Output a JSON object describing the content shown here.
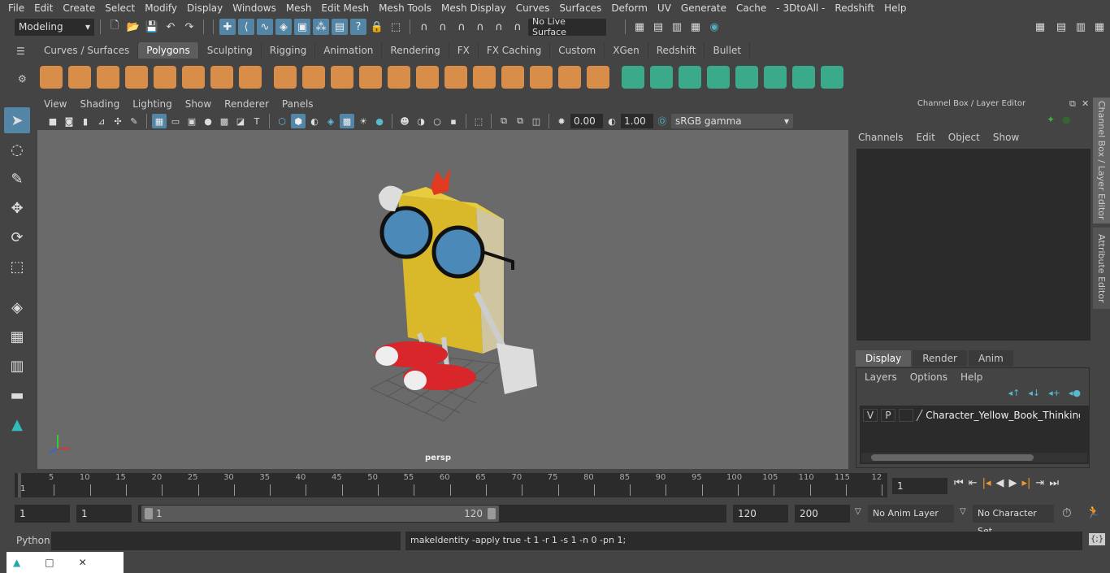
{
  "menubar": [
    "File",
    "Edit",
    "Create",
    "Select",
    "Modify",
    "Display",
    "Windows",
    "Mesh",
    "Edit Mesh",
    "Mesh Tools",
    "Mesh Display",
    "Curves",
    "Surfaces",
    "Deform",
    "UV",
    "Generate",
    "Cache",
    "- 3DtoAll -",
    "Redshift",
    "Help"
  ],
  "status": {
    "workspace": "Modeling",
    "live_surface": "No Live Surface"
  },
  "shelf_tabs": [
    "Curves / Surfaces",
    "Polygons",
    "Sculpting",
    "Rigging",
    "Animation",
    "Rendering",
    "FX",
    "FX Caching",
    "Custom",
    "XGen",
    "Redshift",
    "Bullet"
  ],
  "active_shelf": "Polygons",
  "viewport": {
    "menu": [
      "View",
      "Shading",
      "Lighting",
      "Show",
      "Renderer",
      "Panels"
    ],
    "exposure": "0.00",
    "gamma": "1.00",
    "color_space": "sRGB gamma",
    "camera": "persp"
  },
  "channel_box": {
    "title": "Channel Box / Layer Editor",
    "menu": [
      "Channels",
      "Edit",
      "Object",
      "Show"
    ],
    "layer_tabs": [
      "Display",
      "Render",
      "Anim"
    ],
    "active_layer_tab": "Display",
    "layer_menu": [
      "Layers",
      "Options",
      "Help"
    ],
    "layer": {
      "v": "V",
      "p": "P",
      "name": "Character_Yellow_Book_Thinking_Pos"
    }
  },
  "side_tabs": {
    "channel": "Channel Box / Layer Editor",
    "attribute": "Attribute Editor"
  },
  "timeline": {
    "ticks": [
      "5",
      "10",
      "15",
      "20",
      "25",
      "30",
      "35",
      "40",
      "45",
      "50",
      "55",
      "60",
      "65",
      "70",
      "75",
      "80",
      "85",
      "90",
      "95",
      "100",
      "105",
      "110",
      "115",
      "12"
    ],
    "start_label": "1",
    "current_frame": "1"
  },
  "range": {
    "start": "1",
    "inner_start": "1",
    "slider_start": "1",
    "slider_end": "120",
    "end": "120",
    "max": "200",
    "anim_layer": "No Anim Layer",
    "character_set": "No Character Set"
  },
  "command": {
    "language": "Python",
    "output": "makeIdentity -apply true -t 1 -r 1 -s 1 -n 0 -pn 1;"
  }
}
